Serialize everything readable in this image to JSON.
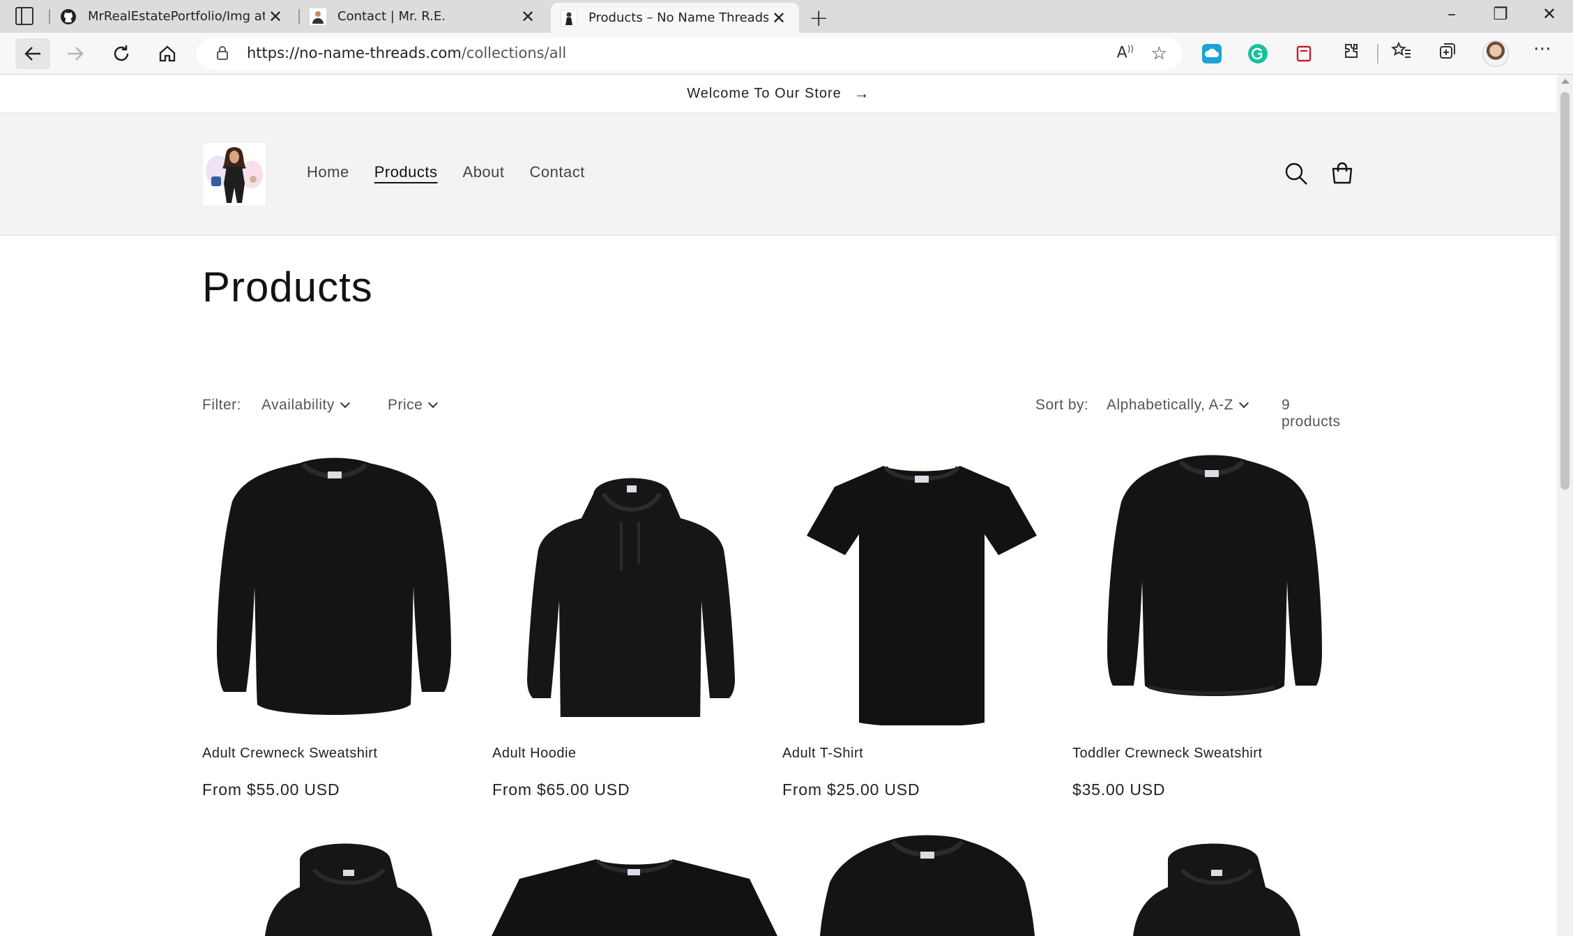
{
  "browser": {
    "tabs": [
      {
        "title": "MrRealEstatePortfolio/Img at ma",
        "favicon": "github-icon",
        "active": false
      },
      {
        "title": "Contact | Mr. R.E.",
        "favicon": "site-avatar-icon",
        "active": false
      },
      {
        "title": "Products – No Name Threads",
        "favicon": "store-logo-icon",
        "active": true
      }
    ],
    "url_host": "https://no-name-threads.com",
    "url_path": "/collections/all",
    "read_aloud_label": "A",
    "window_controls": [
      "–",
      "❐",
      "✕"
    ]
  },
  "store": {
    "announcement": "Welcome To Our Store",
    "nav": [
      {
        "label": "Home",
        "active": false
      },
      {
        "label": "Products",
        "active": true
      },
      {
        "label": "About",
        "active": false
      },
      {
        "label": "Contact",
        "active": false
      }
    ]
  },
  "collection": {
    "title": "Products",
    "filter_label": "Filter:",
    "filters": [
      "Availability",
      "Price"
    ],
    "sort_label": "Sort by:",
    "sort_value": "Alphabetically, A-Z",
    "count": "9 products"
  },
  "products": [
    {
      "name": "Adult Crewneck Sweatshirt",
      "price": "From $55.00 USD",
      "garment": "crewneck"
    },
    {
      "name": "Adult Hoodie",
      "price": "From $65.00 USD",
      "garment": "hoodie"
    },
    {
      "name": "Adult T-Shirt",
      "price": "From $25.00 USD",
      "garment": "tshirt"
    },
    {
      "name": "Toddler Crewneck Sweatshirt",
      "price": "$35.00 USD",
      "garment": "crewneck"
    }
  ],
  "colors": {
    "header_bg": "#f3f3f3",
    "text": "#121212",
    "garment": "#141414"
  }
}
